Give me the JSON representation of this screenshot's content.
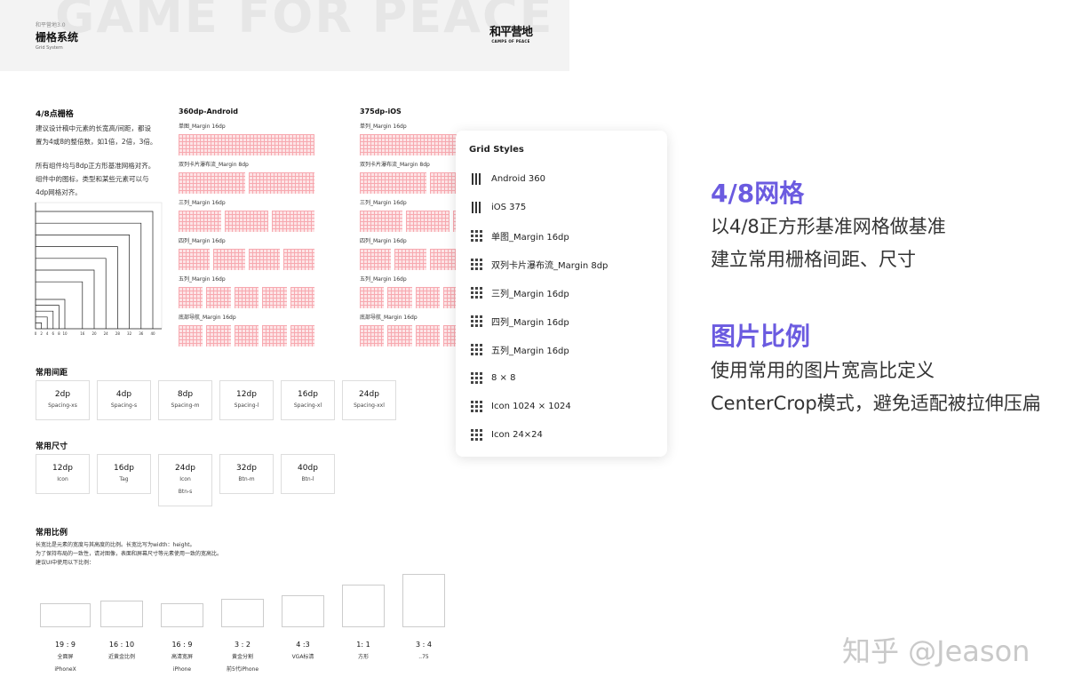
{
  "header": {
    "bg_word": "GAME FOR PEACE",
    "version": "和平营地3.0",
    "title": "栅格系统",
    "subtitle": "Grid System",
    "logo_zh": "和平营地",
    "logo_en": "CAMPS OF PEACE"
  },
  "points_grid": {
    "title": "4/8点栅格",
    "para1": [
      "建议设计稿中元素的长宽高/间距，都设",
      "置为4或8的整倍数，如1倍，2倍，3倍。"
    ],
    "para2": [
      "所有组件均与8dp正方形基准网格对齐。",
      "组件中的图标，类型和某些元素可以与",
      "4dp网格对齐。"
    ],
    "axis_labels": [
      "0",
      "2",
      "4",
      "6",
      "8",
      "10",
      "16",
      "20",
      "24",
      "28",
      "32",
      "36",
      "40"
    ]
  },
  "android": {
    "title": "360dp-Android",
    "rows": [
      "单图_Margin 16dp",
      "双列卡片瀑布流_Margin 8dp",
      "三列_Margin 16dp",
      "四列_Margin 16dp",
      "五列_Margin 16dp",
      "底部导航_Margin 16dp"
    ]
  },
  "ios": {
    "title": "375dp-iOS",
    "rows": [
      "单列_Margin 16dp",
      "双列卡片瀑布流_Margin 8dp",
      "三列_Margin 16dp",
      "四列_Margin 16dp",
      "五列_Margin 16dp",
      "底部导航_Margin 16dp"
    ]
  },
  "spacing": {
    "title": "常用间距",
    "items": [
      {
        "value": "2dp",
        "name": "Spacing-xs"
      },
      {
        "value": "4dp",
        "name": "Spacing-s"
      },
      {
        "value": "8dp",
        "name": "Spacing-m"
      },
      {
        "value": "12dp",
        "name": "Spacing-l"
      },
      {
        "value": "16dp",
        "name": "Spacing-xl"
      },
      {
        "value": "24dp",
        "name": "Spacing-xxl"
      }
    ]
  },
  "sizes": {
    "title": "常用尺寸",
    "items": [
      {
        "value": "12dp",
        "name": "Icon",
        "name2": ""
      },
      {
        "value": "16dp",
        "name": "Tag",
        "name2": ""
      },
      {
        "value": "24dp",
        "name": "Icon",
        "name2": "Btn-s"
      },
      {
        "value": "32dp",
        "name": "Btn-m",
        "name2": ""
      },
      {
        "value": "40dp",
        "name": "Btn-l",
        "name2": ""
      }
    ]
  },
  "ratios": {
    "title": "常用比例",
    "desc": [
      "长宽比是元素的宽度与其高度的比例。长宽比写为width：height。",
      "为了保持布局的一致性，请对图像，表面和屏幕尺寸等元素使用一致的宽高比。",
      "建议UI中使用以下比例："
    ],
    "items": [
      {
        "ratio": "19 : 9",
        "d1": "全面屏",
        "d2": "iPhoneX"
      },
      {
        "ratio": "16 : 10",
        "d1": "近黄金比例",
        "d2": ""
      },
      {
        "ratio": "16 : 9",
        "d1": "高清宽屏",
        "d2": "iPhone"
      },
      {
        "ratio": "3 : 2",
        "d1": "黄金分割",
        "d2": "前5代iPhone"
      },
      {
        "ratio": "4 :3",
        "d1": "VGA标清",
        "d2": ""
      },
      {
        "ratio": "1: 1",
        "d1": "方形",
        "d2": ""
      },
      {
        "ratio": "3 : 4",
        "d1": "..75",
        "d2": ""
      }
    ]
  },
  "panel": {
    "title": "Grid Styles",
    "items": [
      {
        "label": "Android 360",
        "icon": "columns-icon"
      },
      {
        "label": "iOS 375",
        "icon": "columns-icon"
      },
      {
        "label": "单图_Margin 16dp",
        "icon": "grid-dots-icon"
      },
      {
        "label": "双列卡片瀑布流_Margin 8dp",
        "icon": "grid-dots-icon"
      },
      {
        "label": "三列_Margin 16dp",
        "icon": "grid-dots-icon"
      },
      {
        "label": "四列_Margin 16dp",
        "icon": "grid-dots-icon"
      },
      {
        "label": "五列_Margin 16dp",
        "icon": "grid-dots-icon"
      },
      {
        "label": "8 × 8",
        "icon": "grid-dots-icon"
      },
      {
        "label": "Icon 1024 × 1024",
        "icon": "grid-dots-icon"
      },
      {
        "label": "Icon 24×24",
        "icon": "grid-dots-icon"
      }
    ]
  },
  "right": {
    "h1": "4/8网格",
    "p1": [
      "以4/8正方形基准网格做基准",
      "建立常用栅格间距、尺寸"
    ],
    "h2": "图片比例",
    "p2": [
      "使用常用的图片宽高比定义",
      "CenterCrop模式，避免适配被拉伸压扁"
    ]
  },
  "watermark": "知乎 @Jeason",
  "colors": {
    "accent": "#6b5be0",
    "grid_fill": "#fde4e6",
    "grid_line": "#f7a9b0"
  }
}
